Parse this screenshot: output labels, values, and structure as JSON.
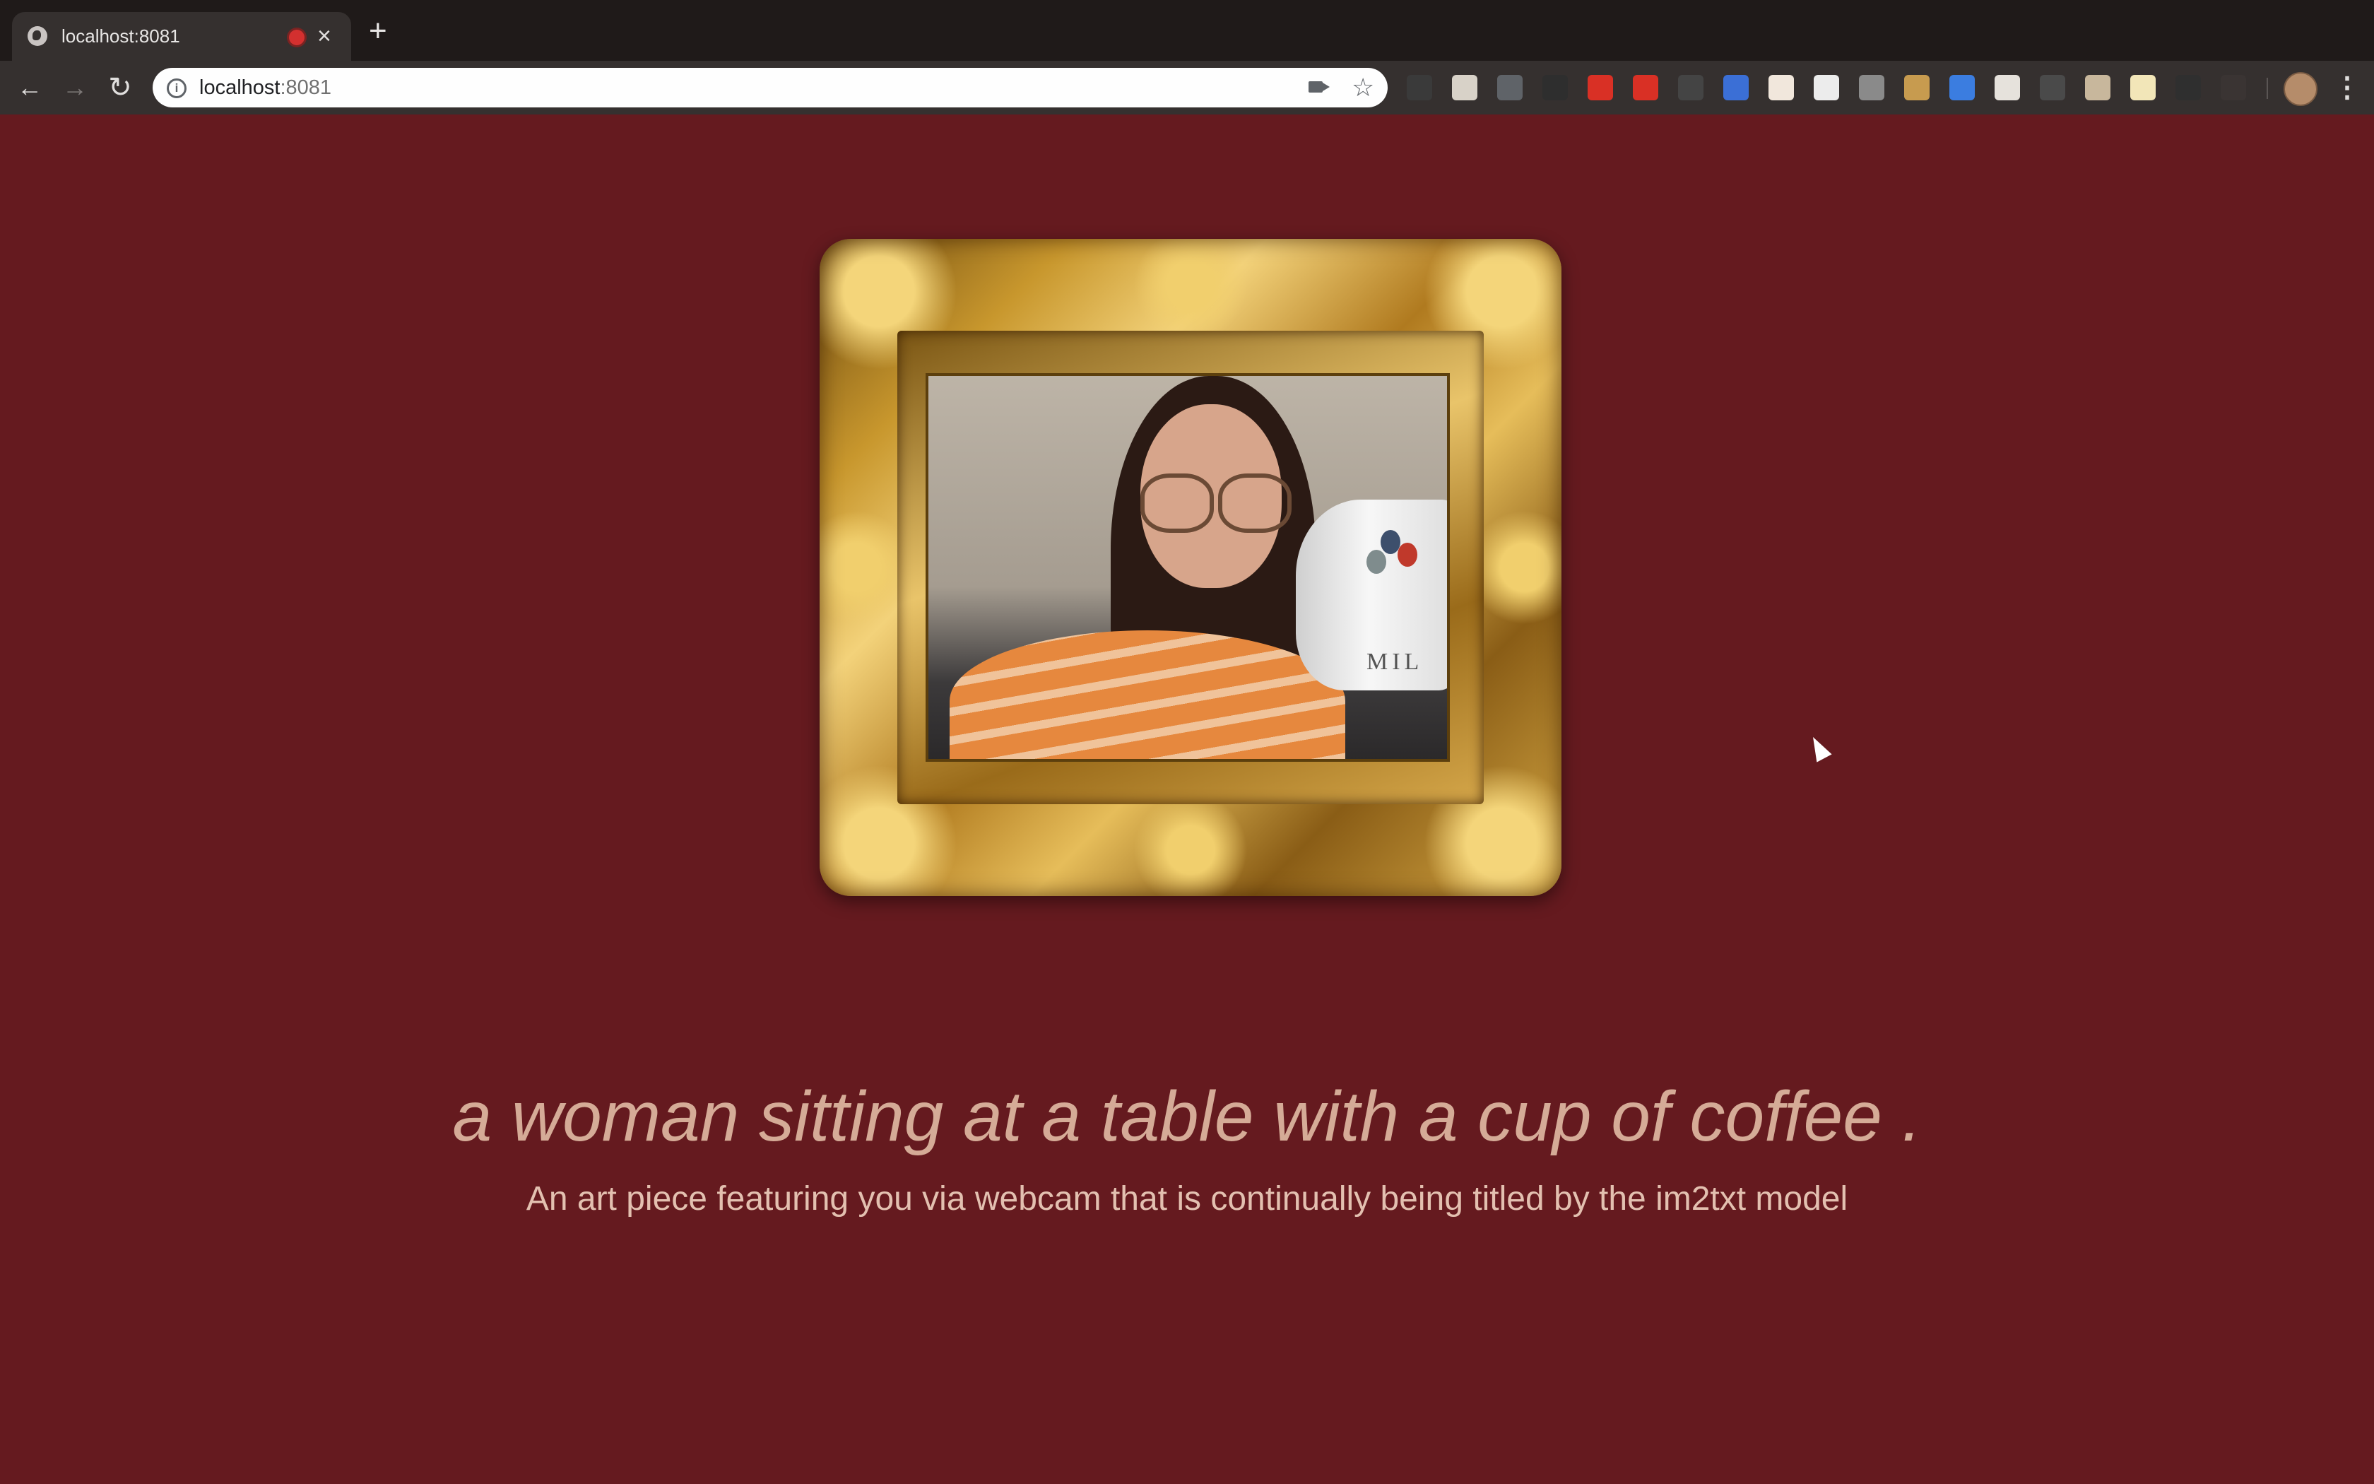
{
  "browser": {
    "tab_title": "localhost:8081",
    "new_tab_label": "+",
    "close_label": "×",
    "url_host": "localhost",
    "url_port": ":8081",
    "extensions": [
      {
        "name": "ext-dark-mode-icon",
        "color": "#3a3a3a"
      },
      {
        "name": "ext-document-icon",
        "color": "#d8d2c8"
      },
      {
        "name": "ext-scissors-icon",
        "color": "#5f6368"
      },
      {
        "name": "ext-flask-icon",
        "color": "#2e2e2e"
      },
      {
        "name": "ext-hand-icon",
        "color": "#d93025"
      },
      {
        "name": "ext-cors-icon",
        "color": "#d93025"
      },
      {
        "name": "ext-octo-icon",
        "color": "#444444"
      },
      {
        "name": "ext-shield-icon",
        "color": "#3b6fd6"
      },
      {
        "name": "ext-ticket-icon",
        "color": "#f1e7dc"
      },
      {
        "name": "ext-ghost-icon",
        "color": "#ececec"
      },
      {
        "name": "ext-laptop-icon",
        "color": "#8a8a8a"
      },
      {
        "name": "ext-notebook-icon",
        "color": "#c79b4f"
      },
      {
        "name": "ext-compass-icon",
        "color": "#3b7de0"
      },
      {
        "name": "ext-clipboard-icon",
        "color": "#e6e2dc"
      },
      {
        "name": "ext-grid-icon",
        "color": "#4a4a4a"
      },
      {
        "name": "ext-star-badge-icon",
        "color": "#c8b79c"
      },
      {
        "name": "ext-note-icon",
        "color": "#f2e6b8"
      },
      {
        "name": "ext-glasses-icon",
        "color": "#2f2f2f"
      },
      {
        "name": "ext-dim-icon",
        "color": "#3a3433"
      }
    ]
  },
  "page": {
    "caption": "a woman sitting at a table with a cup of coffee .",
    "subtitle": "An art piece featuring you via webcam that is continually being titled by the im2txt model",
    "background_color": "#651a1f",
    "mug_text": "MIL"
  }
}
